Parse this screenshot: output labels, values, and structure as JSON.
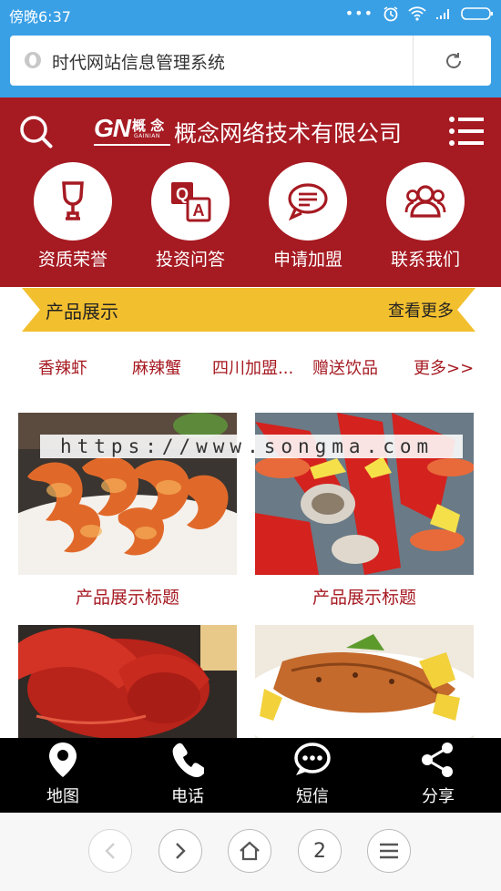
{
  "status_bar": {
    "time": "傍晚6:37"
  },
  "address_bar": {
    "title": "时代网站信息管理系统"
  },
  "header": {
    "logo_mark": "GN",
    "logo_small_chars": "概 念",
    "logo_small_pinyin": "GAINIAN",
    "company_name": "概念网络技术有限公司"
  },
  "categories": [
    {
      "label": "资质荣誉",
      "icon": "trophy-icon"
    },
    {
      "label": "投资问答",
      "icon": "qa-icon"
    },
    {
      "label": "申请加盟",
      "icon": "chat-bubble-icon"
    },
    {
      "label": "联系我们",
      "icon": "users-icon"
    }
  ],
  "section": {
    "title": "产品展示",
    "more": "查看更多"
  },
  "subcategories": [
    "香辣虾",
    "麻辣蟹",
    "四川加盟...",
    "赠送饮品",
    "更多>>"
  ],
  "products": [
    {
      "title": "产品展示标题",
      "image": "shrimp"
    },
    {
      "title": "产品展示标题",
      "image": "seafood-platter"
    },
    {
      "title": "",
      "image": "lobster"
    },
    {
      "title": "",
      "image": "grilled-fish"
    }
  ],
  "watermark": "https://www.songma.com",
  "bottom_nav": [
    {
      "label": "地图",
      "icon": "map-pin-icon"
    },
    {
      "label": "电话",
      "icon": "phone-icon"
    },
    {
      "label": "短信",
      "icon": "sms-icon"
    },
    {
      "label": "分享",
      "icon": "share-icon"
    }
  ],
  "browser_toolbar": {
    "tab_count": "2"
  },
  "colors": {
    "brand_red": "#a61a22",
    "accent_yellow": "#f2bf2f",
    "status_blue": "#3aa0e6"
  }
}
